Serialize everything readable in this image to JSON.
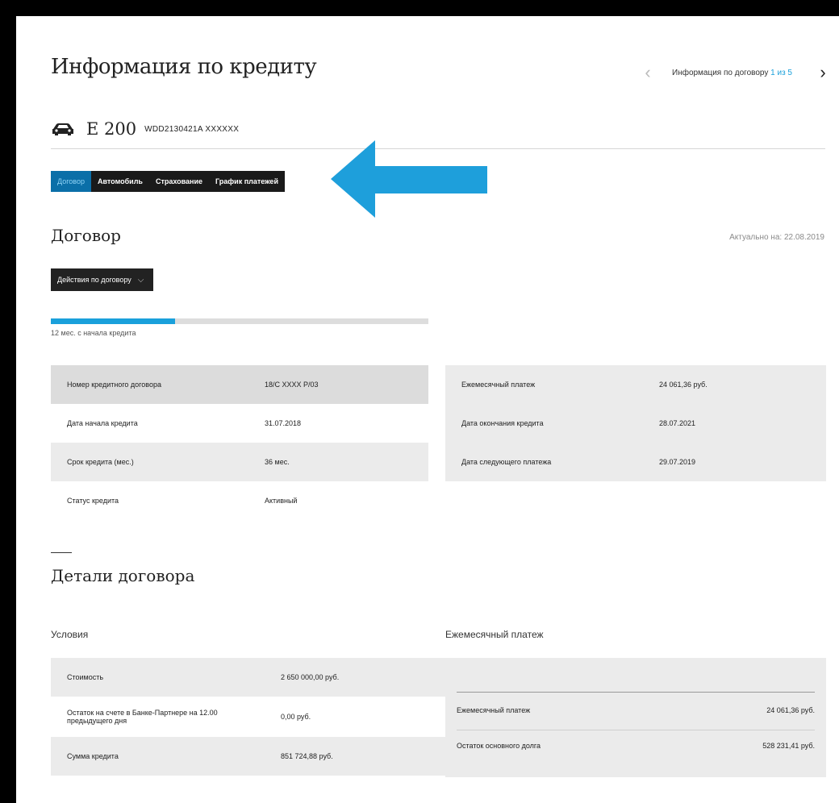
{
  "header": {
    "title": "Информация по кредиту",
    "pager_text": "Информация по договору",
    "pager_current": "1 из 5",
    "prev_icon": "chevron-left-icon",
    "next_icon": "chevron-right-icon"
  },
  "vehicle": {
    "icon": "car-icon",
    "model": "E 200",
    "vin": "WDD2130421A XXXXXX"
  },
  "tabs": [
    {
      "label": "Договор",
      "active": true
    },
    {
      "label": "Автомобиль",
      "active": false
    },
    {
      "label": "Страхование",
      "active": false
    },
    {
      "label": "График платежей",
      "active": false
    }
  ],
  "annotation": {
    "icon": "arrow-left-icon",
    "color": "#1e9fdb"
  },
  "contract": {
    "heading": "Договор",
    "as_of": "Актуально на: 22.08.2019",
    "actions_label": "Действия по договору",
    "progress_fraction": 0.33,
    "progress_label": "12 мес. с начала кредита",
    "left_rows": [
      {
        "label": "Номер кредитного договора",
        "value": "18/С XXXX Р/03"
      },
      {
        "label": "Дата начала кредита",
        "value": "31.07.2018"
      },
      {
        "label": "Срок кредита (мес.)",
        "value": "36 мес."
      },
      {
        "label": "Статус кредита",
        "value": "Активный"
      }
    ],
    "right_rows": [
      {
        "label": "Ежемесячный платеж",
        "value": "24 061,36 руб."
      },
      {
        "label": "Дата окончания кредита",
        "value": "28.07.2021"
      },
      {
        "label": "Дата следующего платежа",
        "value": "29.07.2019"
      }
    ]
  },
  "details": {
    "heading": "Детали договора",
    "conditions_title": "Условия",
    "conditions_rows": [
      {
        "label": "Стоимость",
        "value": "2 650 000,00 руб."
      },
      {
        "label": "Остаток на счете в Банке-Партнере на 12.00 предыдущего дня",
        "value": "0,00 руб."
      },
      {
        "label": "Сумма кредита",
        "value": "851 724,88 руб."
      }
    ],
    "monthly_title": "Ежемесячный платеж",
    "monthly_rows": [
      {
        "label": "Ежемесячный платеж",
        "value": "24 061,36 руб."
      },
      {
        "label": "Остаток основного долга",
        "value": "528 231,41 руб."
      }
    ]
  },
  "colors": {
    "accent": "#1aa0db",
    "dark": "#1a1a1a",
    "row_bg": "#ebebeb"
  }
}
